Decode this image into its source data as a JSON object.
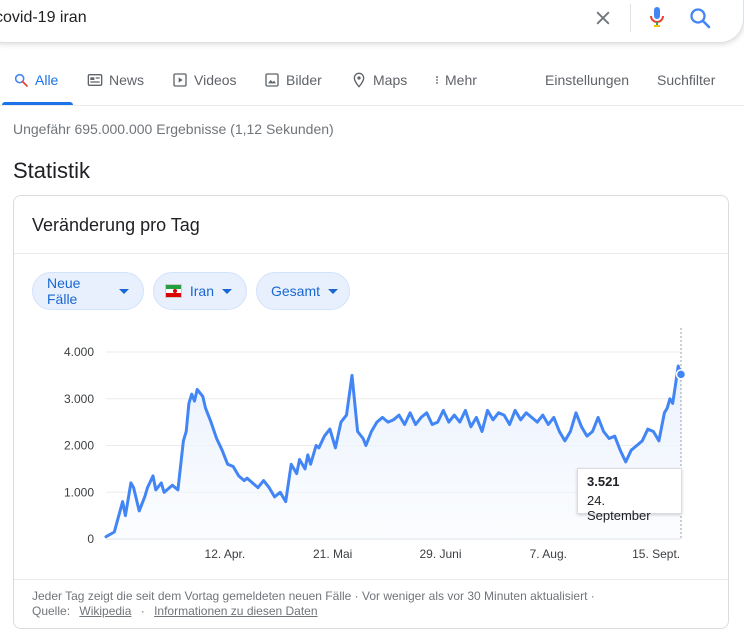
{
  "search": {
    "query": "covid-19 iran"
  },
  "icons": {
    "clear": "close-icon",
    "mic": "mic-icon",
    "search": "search-icon"
  },
  "nav": {
    "tabs": [
      {
        "label": "Alle",
        "icon": "search-icon",
        "active": true
      },
      {
        "label": "News",
        "icon": "news-icon"
      },
      {
        "label": "Videos",
        "icon": "play-icon"
      },
      {
        "label": "Bilder",
        "icon": "image-icon"
      },
      {
        "label": "Maps",
        "icon": "map-pin-icon"
      },
      {
        "label": "Mehr",
        "icon": "more-vert-icon"
      }
    ],
    "settings": "Einstellungen",
    "tools": "Suchfilter"
  },
  "result_stats": "Ungefähr 695.000.000 Ergebnisse (1,12 Sekunden)",
  "section_title": "Statistik",
  "card": {
    "title": "Veränderung pro Tag",
    "chips": [
      {
        "label": "Neue Fälle"
      },
      {
        "label": "Iran",
        "flag": "iran-flag-icon"
      },
      {
        "label": "Gesamt"
      }
    ],
    "tooltip": {
      "value": "3.521",
      "date": "24. September"
    },
    "footer": {
      "note": "Jeder Tag zeigt die seit dem Vortag gemeldeten neuen Fälle · Vor weniger als vor 30 Minuten aktualisiert ·",
      "source_label": "Quelle:",
      "source_link": "Wikipedia",
      "info_link": "Informationen zu diesen Daten",
      "sep": "·"
    }
  },
  "colors": {
    "accent": "#1a73e8",
    "line": "#4285f4",
    "chip_bg": "#e8f0fe",
    "chip_text": "#1967d2",
    "flag_green": "#239f40",
    "flag_red": "#da0000"
  },
  "chart_data": {
    "type": "line",
    "title": "",
    "xlabel": "",
    "ylabel": "",
    "ylim": [
      0,
      4000
    ],
    "yticks": [
      {
        "value": 0,
        "label": "0"
      },
      {
        "value": 1000,
        "label": "1.000"
      },
      {
        "value": 2000,
        "label": "2.000"
      },
      {
        "value": 3000,
        "label": "3.000"
      },
      {
        "value": 4000,
        "label": "4.000"
      }
    ],
    "xticks": [
      {
        "date": "2020-04-12",
        "label": "12. Apr."
      },
      {
        "date": "2020-05-21",
        "label": "21. Mai"
      },
      {
        "date": "2020-06-29",
        "label": "29. Juni"
      },
      {
        "date": "2020-08-07",
        "label": "7. Aug."
      },
      {
        "date": "2020-09-15",
        "label": "15. Sept."
      }
    ],
    "x_range": [
      "2020-02-29",
      "2020-09-24"
    ],
    "grid": true,
    "highlight": {
      "date": "2020-09-24",
      "value": 3521
    },
    "series": [
      {
        "x": [
          "2020-02-29",
          "2020-03-03",
          "2020-03-06",
          "2020-03-07",
          "2020-03-09",
          "2020-03-10",
          "2020-03-12",
          "2020-03-14",
          "2020-03-15",
          "2020-03-17",
          "2020-03-18",
          "2020-03-20",
          "2020-03-21",
          "2020-03-23",
          "2020-03-24",
          "2020-03-26",
          "2020-03-28",
          "2020-03-29",
          "2020-03-30",
          "2020-03-31",
          "2020-04-01",
          "2020-04-02",
          "2020-04-04",
          "2020-04-05",
          "2020-04-07",
          "2020-04-09",
          "2020-04-11",
          "2020-04-13",
          "2020-04-15",
          "2020-04-17",
          "2020-04-19",
          "2020-04-20",
          "2020-04-22",
          "2020-04-24",
          "2020-04-26",
          "2020-04-28",
          "2020-04-30",
          "2020-05-02",
          "2020-05-04",
          "2020-05-06",
          "2020-05-08",
          "2020-05-09",
          "2020-05-11",
          "2020-05-12",
          "2020-05-13",
          "2020-05-15",
          "2020-05-16",
          "2020-05-18",
          "2020-05-20",
          "2020-05-22",
          "2020-05-24",
          "2020-05-26",
          "2020-05-28",
          "2020-05-30",
          "2020-06-01",
          "2020-06-02",
          "2020-06-04",
          "2020-06-06",
          "2020-06-08",
          "2020-06-10",
          "2020-06-12",
          "2020-06-14",
          "2020-06-16",
          "2020-06-18",
          "2020-06-20",
          "2020-06-22",
          "2020-06-24",
          "2020-06-26",
          "2020-06-28",
          "2020-06-30",
          "2020-07-02",
          "2020-07-04",
          "2020-07-06",
          "2020-07-08",
          "2020-07-10",
          "2020-07-12",
          "2020-07-14",
          "2020-07-16",
          "2020-07-18",
          "2020-07-20",
          "2020-07-22",
          "2020-07-24",
          "2020-07-26",
          "2020-07-28",
          "2020-07-30",
          "2020-08-01",
          "2020-08-03",
          "2020-08-05",
          "2020-08-07",
          "2020-08-09",
          "2020-08-11",
          "2020-08-13",
          "2020-08-15",
          "2020-08-17",
          "2020-08-19",
          "2020-08-21",
          "2020-08-23",
          "2020-08-25",
          "2020-08-27",
          "2020-08-29",
          "2020-08-31",
          "2020-09-02",
          "2020-09-04",
          "2020-09-06",
          "2020-09-08",
          "2020-09-10",
          "2020-09-12",
          "2020-09-14",
          "2020-09-16",
          "2020-09-18",
          "2020-09-19",
          "2020-09-20",
          "2020-09-21",
          "2020-09-22",
          "2020-09-23",
          "2020-09-24"
        ],
        "y": [
          50,
          150,
          800,
          500,
          1200,
          1100,
          600,
          900,
          1100,
          1350,
          1050,
          1200,
          1000,
          1100,
          1150,
          1050,
          2100,
          2300,
          2900,
          3100,
          2950,
          3200,
          3050,
          2800,
          2500,
          2150,
          1900,
          1600,
          1550,
          1350,
          1250,
          1300,
          1200,
          1100,
          1250,
          1100,
          900,
          1000,
          800,
          1600,
          1400,
          1700,
          1500,
          1800,
          1600,
          2000,
          1950,
          2200,
          2350,
          1950,
          2500,
          2650,
          3500,
          2300,
          2150,
          2000,
          2300,
          2500,
          2600,
          2500,
          2550,
          2650,
          2450,
          2700,
          2450,
          2600,
          2700,
          2450,
          2500,
          2750,
          2500,
          2650,
          2500,
          2750,
          2400,
          2600,
          2300,
          2750,
          2550,
          2700,
          2650,
          2450,
          2750,
          2550,
          2700,
          2600,
          2500,
          2650,
          2450,
          2600,
          2300,
          2100,
          2300,
          2700,
          2400,
          2200,
          2300,
          2600,
          2300,
          2150,
          2200,
          1900,
          1650,
          1900,
          2000,
          2100,
          2350,
          2300,
          2100,
          2700,
          2800,
          3000,
          2900,
          3300,
          3700,
          3521
        ]
      }
    ]
  }
}
